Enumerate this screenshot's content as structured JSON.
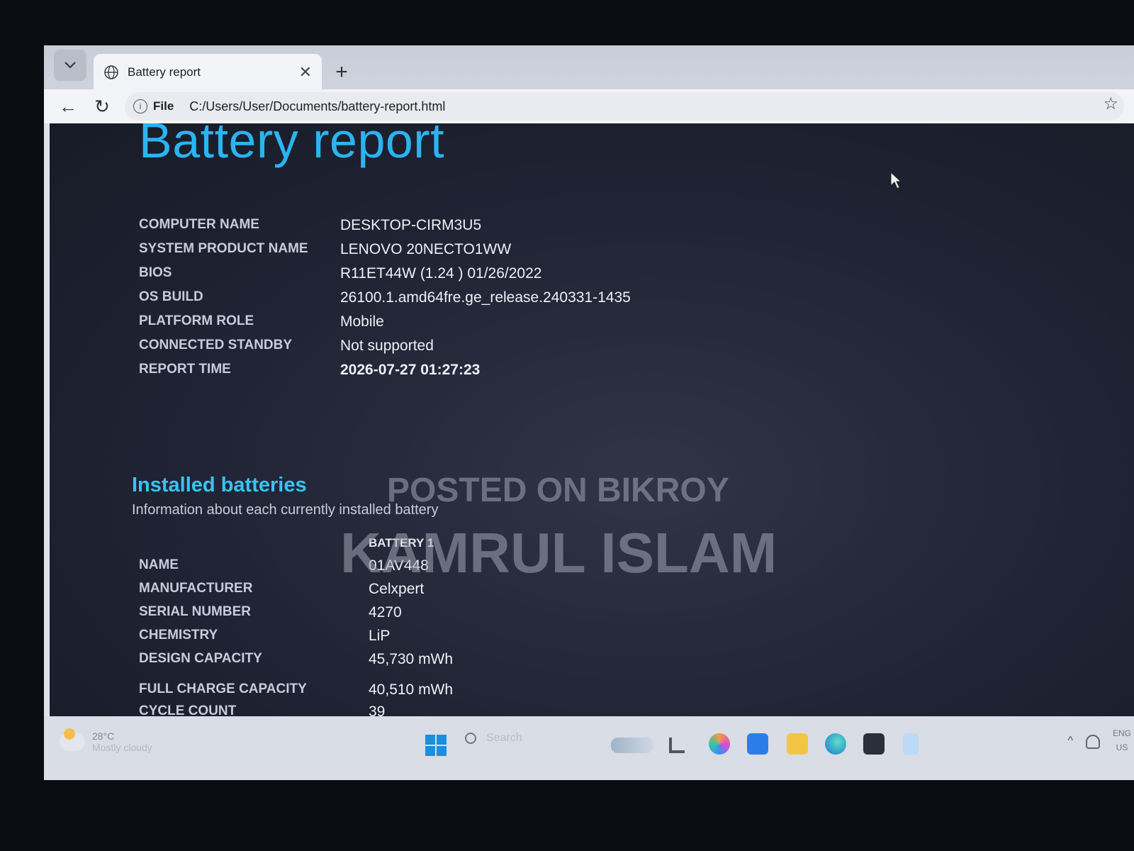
{
  "browser": {
    "tab_title": "Battery report",
    "tab_close": "✕",
    "new_tab": "+",
    "back": "←",
    "reload": "↻",
    "address_scheme": "File",
    "address_url": "C:/Users/User/Documents/battery-report.html"
  },
  "report": {
    "title": "Battery report",
    "system_info": [
      {
        "label": "COMPUTER NAME",
        "value": "DESKTOP-CIRM3U5"
      },
      {
        "label": "SYSTEM PRODUCT NAME",
        "value": "LENOVO 20NECTO1WW"
      },
      {
        "label": "BIOS",
        "value": "R11ET44W (1.24 ) 01/26/2022"
      },
      {
        "label": "OS BUILD",
        "value": "26100.1.amd64fre.ge_release.240331-1435"
      },
      {
        "label": "PLATFORM ROLE",
        "value": "Mobile"
      },
      {
        "label": "CONNECTED STANDBY",
        "value": "Not supported"
      },
      {
        "label": "REPORT TIME",
        "value": "2026-07-27  01:27:23"
      }
    ],
    "installed_batteries": {
      "title": "Installed batteries",
      "subtitle": "Information about each currently installed battery",
      "column_header": "BATTERY 1",
      "rows": [
        {
          "label": "NAME",
          "value": "01AV448"
        },
        {
          "label": "MANUFACTURER",
          "value": "Celxpert"
        },
        {
          "label": "SERIAL NUMBER",
          "value": "4270"
        },
        {
          "label": "CHEMISTRY",
          "value": "LiP"
        },
        {
          "label": "DESIGN CAPACITY",
          "value": "45,730 mWh"
        },
        {
          "label": "FULL CHARGE CAPACITY",
          "value": "40,510 mWh"
        },
        {
          "label": "CYCLE COUNT",
          "value": "39"
        }
      ]
    }
  },
  "watermark": {
    "line1": "POSTED ON BIKROY",
    "line2": "KAMRUL ISLAM"
  },
  "taskbar": {
    "weather_temp": "28°C",
    "weather_desc": "Mostly cloudy",
    "search_placeholder": "Search",
    "lang_line1": "ENG",
    "lang_line2": "US"
  },
  "colors": {
    "title_accent": "#2ab4f0",
    "section_accent": "#38c4f0",
    "content_bg": "#1f2333"
  }
}
